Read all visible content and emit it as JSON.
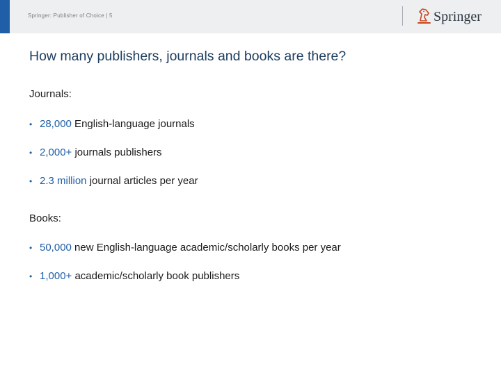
{
  "header": {
    "label": "Springer: Publisher of Choice | 5",
    "logo_text": "Springer",
    "colors": {
      "accent": "#1f5fa8",
      "band": "#eeeff1"
    }
  },
  "title": "How many publishers, journals and books are there?",
  "sections": [
    {
      "heading": "Journals:",
      "bullets": [
        {
          "highlight": "28,000",
          "text": " English-language journals"
        },
        {
          "highlight": "2,000+",
          "text": " journals publishers"
        },
        {
          "highlight": "2.3 million",
          "text": " journal articles per year"
        }
      ]
    },
    {
      "heading": "Books:",
      "bullets": [
        {
          "highlight": "50,000",
          "text": " new English-language academic/scholarly books per year"
        },
        {
          "highlight": "1,000+",
          "text": " academic/scholarly book publishers"
        }
      ]
    }
  ],
  "icons": {
    "bullet": "bullet-dot-icon",
    "logo": "springer-knight-icon"
  },
  "highlight_color": "#1f5fa8"
}
